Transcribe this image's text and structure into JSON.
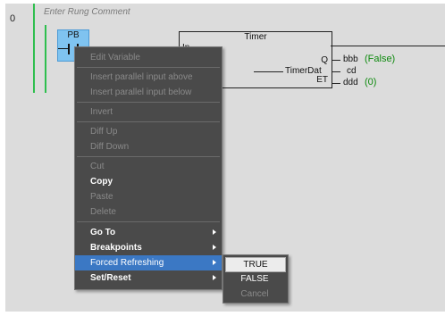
{
  "rung": {
    "number": "0",
    "comment": "Enter Rung Comment"
  },
  "contact": {
    "variable": "PB"
  },
  "timer": {
    "title": "Timer",
    "input": "In",
    "pins": {
      "q": "Q",
      "timer_data": "TimerDat",
      "et": "ET"
    }
  },
  "outputs": {
    "q_var": "bbb",
    "q_value": "(False)",
    "timer_var": "cd",
    "et_var": "ddd",
    "et_value": "(0)"
  },
  "context_menu": {
    "edit_variable": "Edit Variable",
    "insert_parallel_above": "Insert parallel input above",
    "insert_parallel_below": "Insert parallel input below",
    "invert": "Invert",
    "diff_up": "Diff Up",
    "diff_down": "Diff Down",
    "cut": "Cut",
    "copy": "Copy",
    "paste": "Paste",
    "delete": "Delete",
    "go_to": "Go To",
    "breakpoints": "Breakpoints",
    "forced_refreshing": "Forced Refreshing",
    "set_reset": "Set/Reset"
  },
  "submenu": {
    "true": "TRUE",
    "false": "FALSE",
    "cancel": "Cancel"
  },
  "colors": {
    "rail": "#2fbf4f",
    "selection": "#7fc3f0",
    "menu_bg": "#4a4a4a",
    "highlight": "#3b78c4",
    "value_green": "#0e8a0e"
  }
}
